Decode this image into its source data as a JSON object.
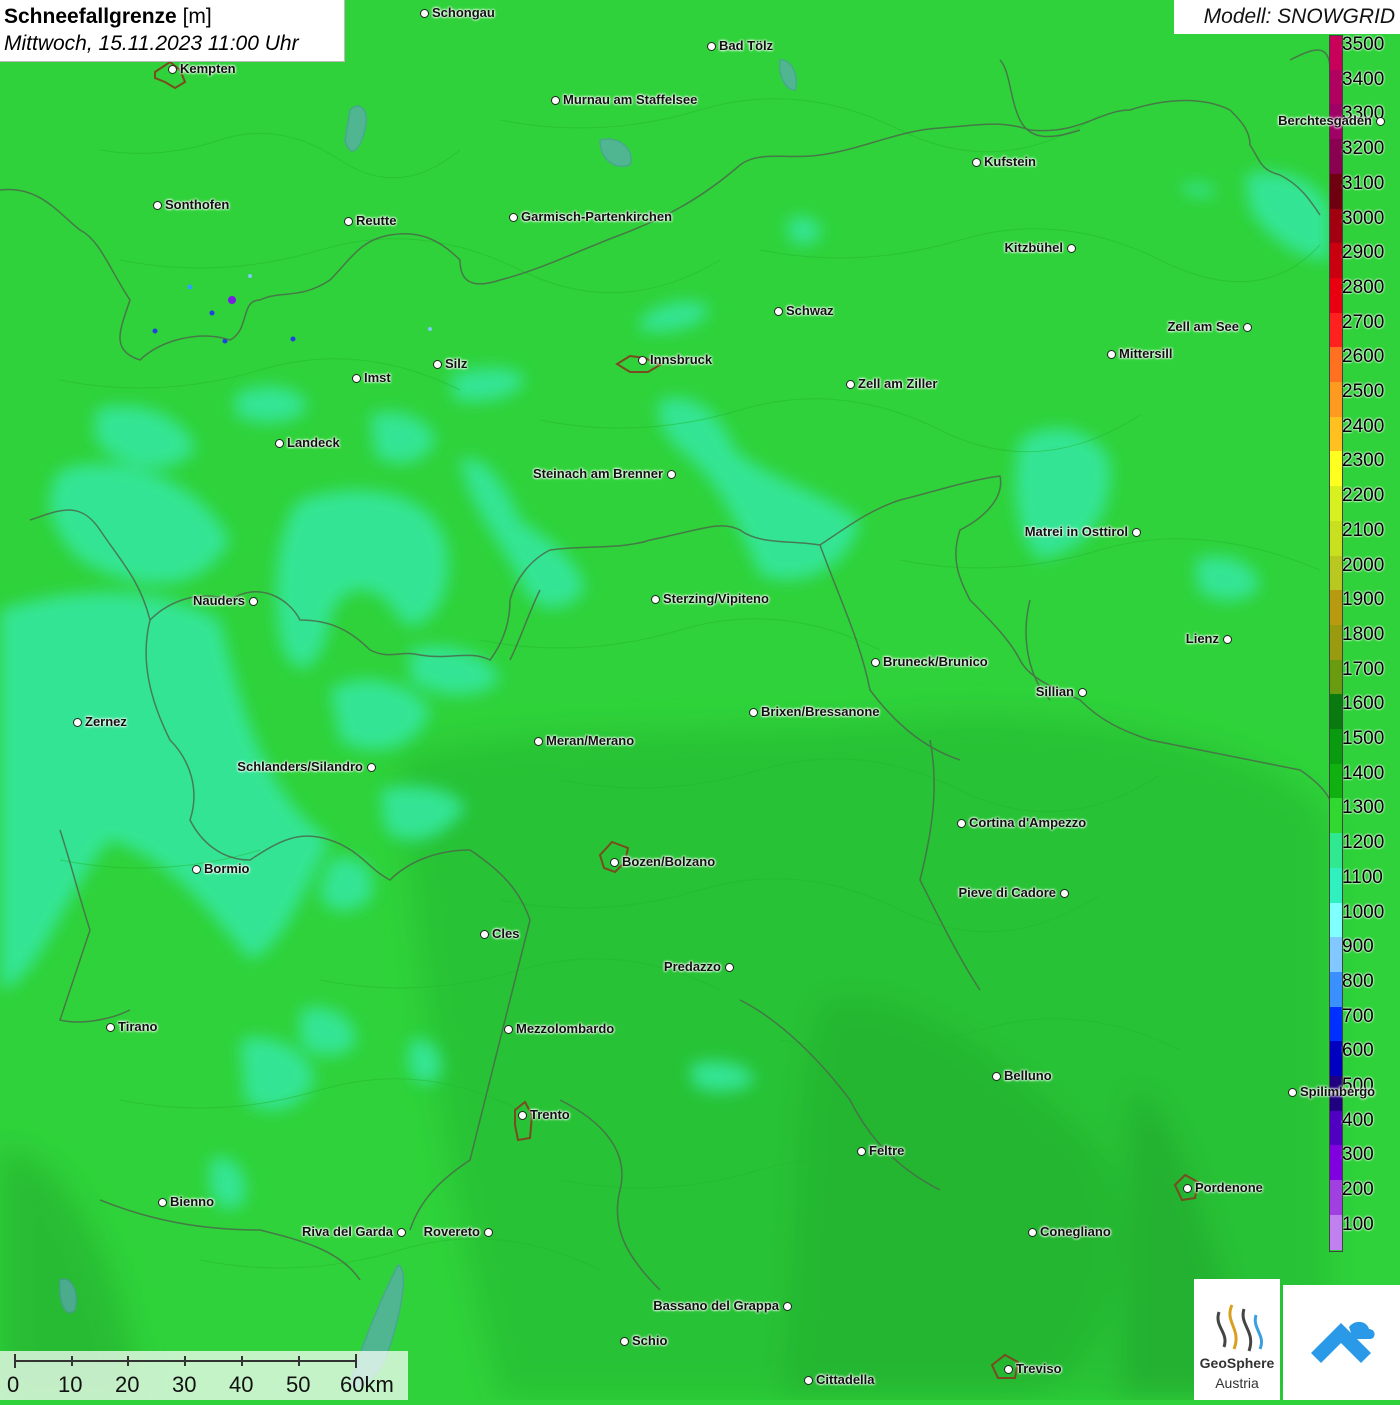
{
  "title": {
    "main": "Schneefallgrenze",
    "unit": "[m]",
    "datetime": "Mittwoch, 15.11.2023 11:00 Uhr"
  },
  "model_label": "Modell: SNOWGRID",
  "legend": {
    "items": [
      {
        "value": "3500",
        "color": "#c8005a"
      },
      {
        "value": "3400",
        "color": "#b00060"
      },
      {
        "value": "3300",
        "color": "#a00066"
      },
      {
        "value": "3200",
        "color": "#8a0050"
      },
      {
        "value": "3100",
        "color": "#6e0010"
      },
      {
        "value": "3000",
        "color": "#a00010"
      },
      {
        "value": "2900",
        "color": "#c80010"
      },
      {
        "value": "2800",
        "color": "#e80010"
      },
      {
        "value": "2700",
        "color": "#ff2020"
      },
      {
        "value": "2600",
        "color": "#ff7020"
      },
      {
        "value": "2500",
        "color": "#ff9a20"
      },
      {
        "value": "2400",
        "color": "#ffc020"
      },
      {
        "value": "2300",
        "color": "#ffff20"
      },
      {
        "value": "2200",
        "color": "#d8f020"
      },
      {
        "value": "2100",
        "color": "#c8e020"
      },
      {
        "value": "2000",
        "color": "#b8c820"
      },
      {
        "value": "1900",
        "color": "#b89a10"
      },
      {
        "value": "1800",
        "color": "#9a9a10"
      },
      {
        "value": "1700",
        "color": "#6a9a10"
      },
      {
        "value": "1600",
        "color": "#0a7a10"
      },
      {
        "value": "1500",
        "color": "#0a9a10"
      },
      {
        "value": "1400",
        "color": "#10b010"
      },
      {
        "value": "1300",
        "color": "#30d830"
      },
      {
        "value": "1200",
        "color": "#30e890"
      },
      {
        "value": "1100",
        "color": "#30f0c0"
      },
      {
        "value": "1000",
        "color": "#80ffff"
      },
      {
        "value": "900",
        "color": "#80c8ff"
      },
      {
        "value": "800",
        "color": "#3a90ff"
      },
      {
        "value": "700",
        "color": "#0030ff"
      },
      {
        "value": "600",
        "color": "#0000c0"
      },
      {
        "value": "500",
        "color": "#200080"
      },
      {
        "value": "400",
        "color": "#5000c0"
      },
      {
        "value": "300",
        "color": "#8000e0"
      },
      {
        "value": "200",
        "color": "#a040e0"
      },
      {
        "value": "100",
        "color": "#c080f0"
      }
    ]
  },
  "cities": [
    {
      "name": "Schongau"
    },
    {
      "name": "Bad Tölz"
    },
    {
      "name": "Kempten"
    },
    {
      "name": "Murnau am Staffelsee"
    },
    {
      "name": "Berchtesgaden"
    },
    {
      "name": "Kufstein"
    },
    {
      "name": "Sonthofen"
    },
    {
      "name": "Reutte"
    },
    {
      "name": "Garmisch-Partenkirchen"
    },
    {
      "name": "Kitzbühel"
    },
    {
      "name": "Schwaz"
    },
    {
      "name": "Zell am See"
    },
    {
      "name": "Innsbruck"
    },
    {
      "name": "Mittersill"
    },
    {
      "name": "Imst"
    },
    {
      "name": "Silz"
    },
    {
      "name": "Zell am Ziller"
    },
    {
      "name": "Landeck"
    },
    {
      "name": "Steinach am Brenner"
    },
    {
      "name": "Matrei in Osttirol"
    },
    {
      "name": "Nauders"
    },
    {
      "name": "Sterzing/Vipiteno"
    },
    {
      "name": "Lienz"
    },
    {
      "name": "Bruneck/Brunico"
    },
    {
      "name": "Sillian"
    },
    {
      "name": "Zernez"
    },
    {
      "name": "Brixen/Bressanone"
    },
    {
      "name": "Meran/Merano"
    },
    {
      "name": "Schlanders/Silandro"
    },
    {
      "name": "Cortina d'Ampezzo"
    },
    {
      "name": "Bozen/Bolzano"
    },
    {
      "name": "Bormio"
    },
    {
      "name": "Pieve di Cadore"
    },
    {
      "name": "Cles"
    },
    {
      "name": "Predazzo"
    },
    {
      "name": "Tirano"
    },
    {
      "name": "Mezzolombardo"
    },
    {
      "name": "Belluno"
    },
    {
      "name": "Spilimbergo"
    },
    {
      "name": "Trento"
    },
    {
      "name": "Feltre"
    },
    {
      "name": "Pordenone"
    },
    {
      "name": "Bienno"
    },
    {
      "name": "Riva del Garda"
    },
    {
      "name": "Rovereto"
    },
    {
      "name": "Conegliano"
    },
    {
      "name": "Bassano del Grappa"
    },
    {
      "name": "Schio"
    },
    {
      "name": "Treviso"
    },
    {
      "name": "Cittadella"
    }
  ],
  "scale": {
    "ticks": [
      "0",
      "10",
      "20",
      "30",
      "40",
      "50",
      "60km"
    ]
  },
  "logos": {
    "geosphere": [
      "GeoSphere",
      "Austria"
    ]
  }
}
